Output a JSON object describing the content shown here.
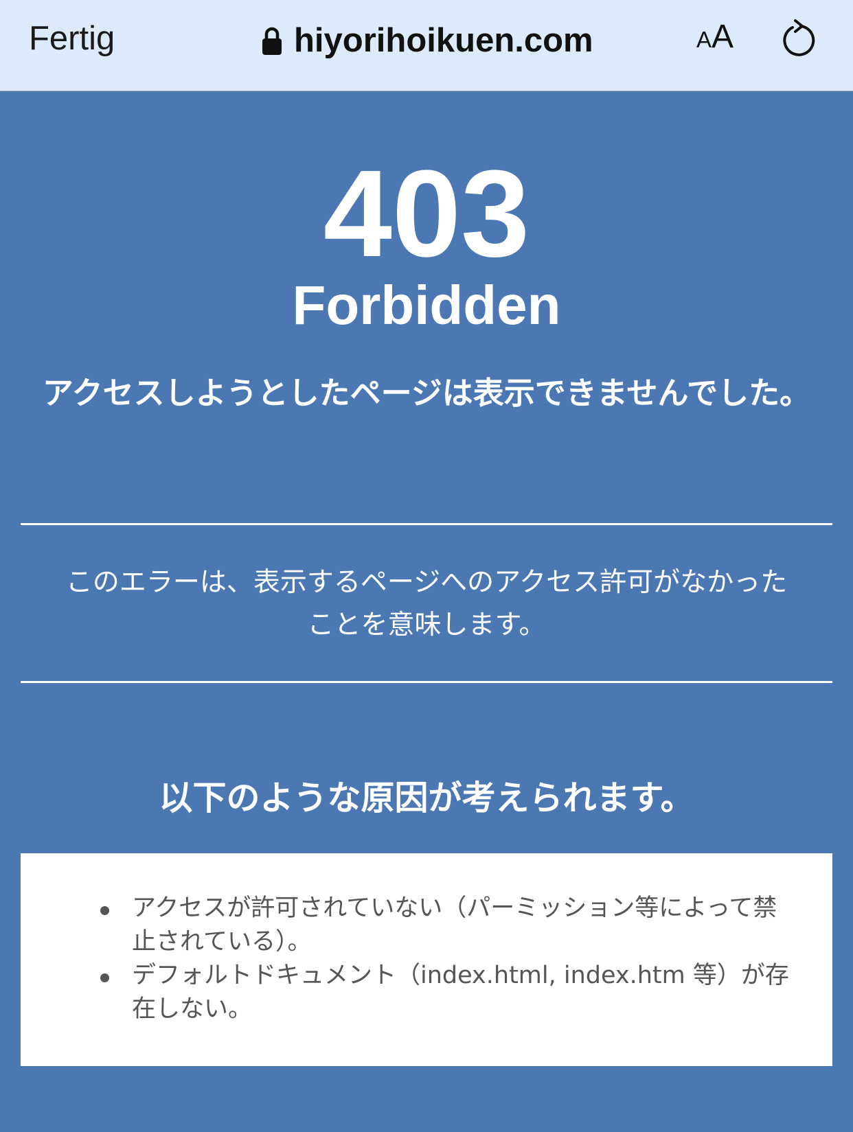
{
  "browser": {
    "done_label": "Fertig",
    "url": "hiyorihoikuen.com",
    "text_size_small": "A",
    "text_size_big": "A",
    "icons": [
      "lock-icon",
      "text-size-icon",
      "reload-icon"
    ]
  },
  "error": {
    "code": "403",
    "status": "Forbidden",
    "lead": "アクセスしようとしたページは表示できませんでした。",
    "description": "このエラーは、表示するページへのアクセス許可がなかったことを意味します。",
    "causes_title": "以下のような原因が考えられます。",
    "causes": [
      "アクセスが許可されていない（パーミッション等によって禁止されている）。",
      "デフォルトドキュメント（index.html, index.htm 等）が存在しない。"
    ]
  },
  "colors": {
    "page_background": "#4b77b2",
    "toolbar_background": "#ddeafa",
    "text_light": "#ffffff",
    "list_text": "#555555"
  }
}
